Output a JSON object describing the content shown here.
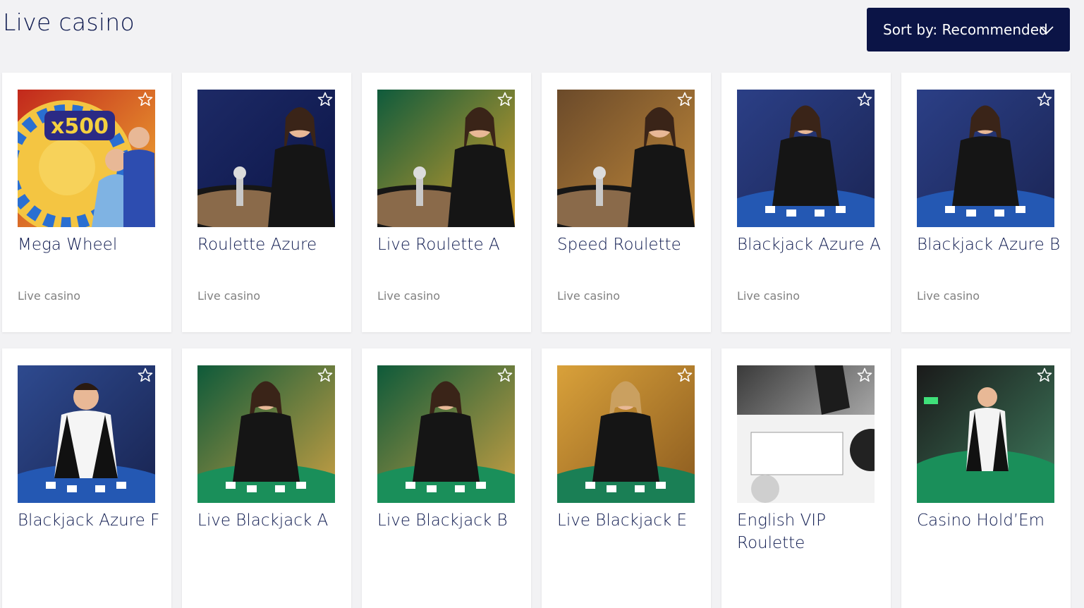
{
  "page": {
    "title": "Live casino",
    "sort_label": "Sort by: Recommended"
  },
  "games": [
    {
      "title": "Mega Wheel",
      "category": "Live casino",
      "scene": "wheel"
    },
    {
      "title": "Roulette Azure",
      "category": "Live casino",
      "scene": "roulette-blue"
    },
    {
      "title": "Live Roulette A",
      "category": "Live casino",
      "scene": "roulette-green"
    },
    {
      "title": "Speed Roulette",
      "category": "Live casino",
      "scene": "roulette-gold"
    },
    {
      "title": "Blackjack Azure A",
      "category": "Live casino",
      "scene": "blackjack-blue"
    },
    {
      "title": "Blackjack Azure B",
      "category": "Live casino",
      "scene": "blackjack-blue"
    },
    {
      "title": "Blackjack Azure F",
      "category": "",
      "scene": "blackjack-blue-m"
    },
    {
      "title": "Live Blackjack A",
      "category": "",
      "scene": "blackjack-green"
    },
    {
      "title": "Live Blackjack B",
      "category": "",
      "scene": "blackjack-green"
    },
    {
      "title": "Live Blackjack E",
      "category": "",
      "scene": "blackjack-gold"
    },
    {
      "title": "English VIP Roulette",
      "category": "",
      "scene": "vip-roulette"
    },
    {
      "title": "Casino Hold’Em",
      "category": "",
      "scene": "holdem"
    }
  ],
  "colors": {
    "accent": "#0b1446",
    "title_text": "#0e1a4f",
    "muted_text": "#808080",
    "background": "#f2f2f4"
  },
  "icons": {
    "sort": "chevron-down-icon",
    "favourite": "star-outline-icon"
  }
}
